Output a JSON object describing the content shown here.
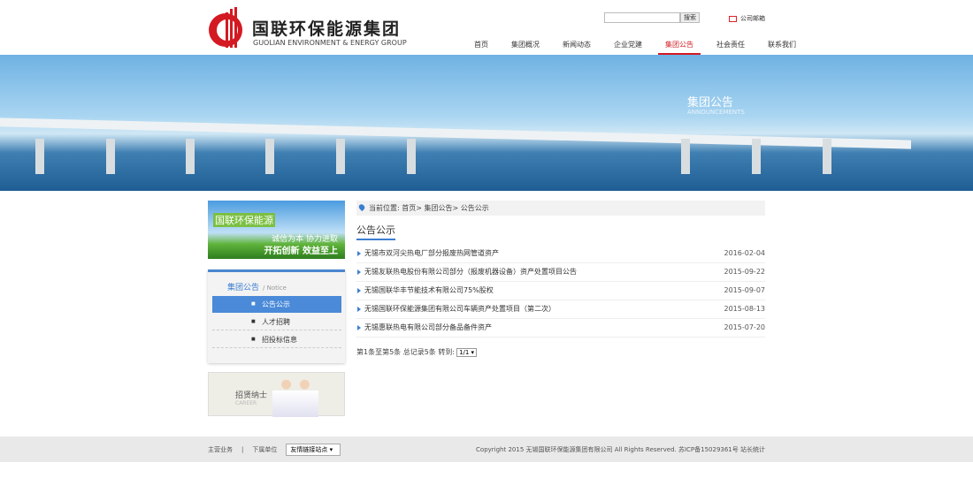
{
  "header": {
    "logo_cn": "国联环保能源集团",
    "logo_en": "GUOLIAN ENVIRONMENT & ENERGY GROUP",
    "search_placeholder": "",
    "search_button": "搜索",
    "mail_label": "公司邮箱"
  },
  "nav": [
    {
      "label": "首页"
    },
    {
      "label": "集团概况"
    },
    {
      "label": "新闻动态"
    },
    {
      "label": "企业党建"
    },
    {
      "label": "集团公告",
      "active": true
    },
    {
      "label": "社会责任"
    },
    {
      "label": "联系我们"
    }
  ],
  "banner": {
    "title": "集团公告",
    "subtitle": "ANNOUNCEMENTS"
  },
  "sidebar": {
    "promo": {
      "brand": "国联环保能源",
      "line1": "诚信为本 协力进取",
      "line2": "开拓创新 效益至上"
    },
    "title": "集团公告",
    "title_en": "/ Notice",
    "items": [
      {
        "label": "公告公示"
      },
      {
        "label": "人才招聘"
      },
      {
        "label": "招投标信息"
      }
    ],
    "career": {
      "title": "招贤纳士",
      "subtitle": "CAREER"
    }
  },
  "breadcrumb": "当前位置: 首页> 集团公告> 公告公示",
  "section_title": "公告公示",
  "list": [
    {
      "title": "无锡市双河尖热电厂部分报废热网管道资产",
      "date": "2016-02-04"
    },
    {
      "title": "无锡友联热电股份有限公司部分（报废机器设备）资产处置项目公告",
      "date": "2015-09-22"
    },
    {
      "title": "无锡国联华丰节能技术有限公司75%股权",
      "date": "2015-09-07"
    },
    {
      "title": "无锡国联环保能源集团有限公司车辆资产处置项目（第二次）",
      "date": "2015-08-13"
    },
    {
      "title": "无锡惠联热电有限公司部分备品备件资产",
      "date": "2015-07-20"
    }
  ],
  "pager": {
    "text": "第1条至第5条 总记录5条 转到:",
    "page": "1/1 ▾"
  },
  "footer": {
    "link1": "主营业务",
    "sep": "|",
    "link2": "下属单位",
    "select": "友情链接站点",
    "copyright": "Copyright 2015 无锡国联环保能源集团有限公司 All Rights Reserved.  苏ICP备15029361号 站长统计"
  }
}
